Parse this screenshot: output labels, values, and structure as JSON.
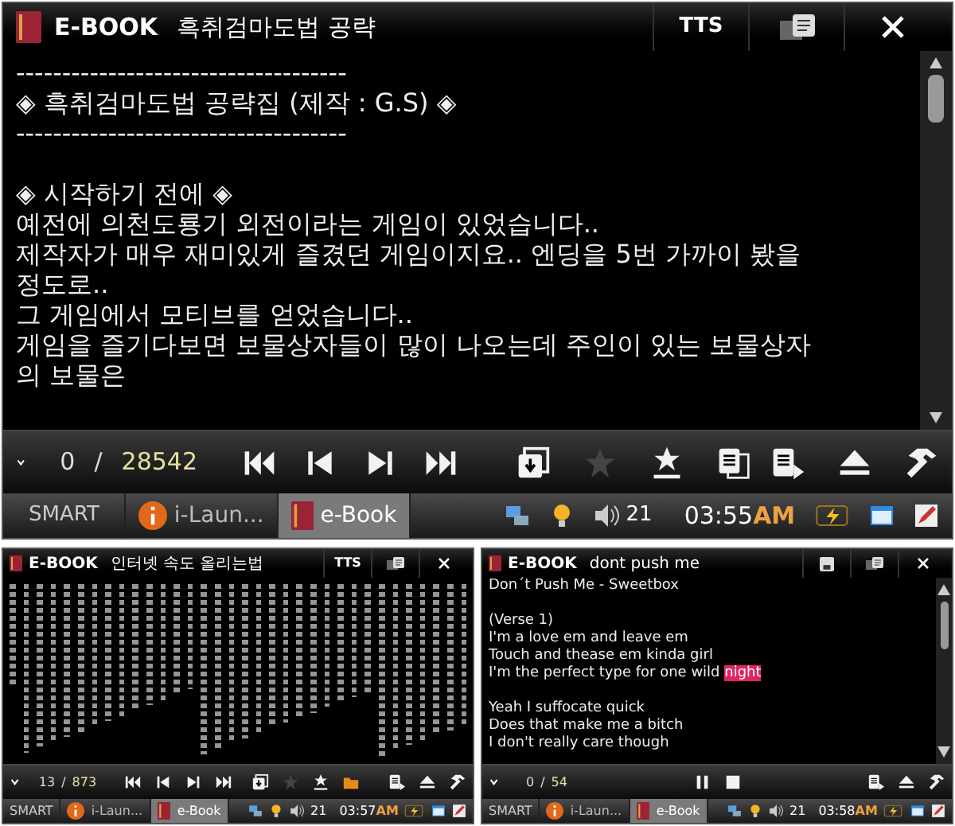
{
  "screens": [
    {
      "window": {
        "app": "E-BOOK",
        "title": "흑취검마도법 공략",
        "buttons": [
          {
            "kind": "text",
            "label": "TTS"
          },
          {
            "kind": "window"
          },
          {
            "kind": "close"
          }
        ]
      },
      "content": {
        "kind": "text",
        "paragraphs": [
          [
            {
              "text": "------------------------------------"
            },
            {
              "text": "◈ 흑취검마도법 공략집 (제작 : G.S) ◈"
            },
            {
              "text": "------------------------------------"
            }
          ],
          [
            {
              "text": "◈ 시작하기 전에 ◈"
            },
            {
              "text": "예전에 의천도룡기 외전이라는 게임이 있었습니다.."
            },
            {
              "text": "제작자가 매우 재미있게 즐겼던 게임이지요.. 엔딩을 5번 가까이 봤을"
            },
            {
              "text": "정도로.."
            },
            {
              "text": "그 게임에서 모티브를 얻었습니다.."
            },
            {
              "text": "게임을 즐기다보면 보물상자들이 많이 나오는데 주인이 있는 보물상자"
            },
            {
              "text": "의 보물은"
            }
          ]
        ]
      },
      "toolbar": {
        "page": "0",
        "separator": "/",
        "total": "28542",
        "navigation": [
          {
            "kind": "first",
            "dimmed": false
          },
          {
            "kind": "prev",
            "dimmed": false
          },
          {
            "kind": "next",
            "dimmed": false
          },
          {
            "kind": "last",
            "dimmed": false
          }
        ],
        "bookmarks": [
          {
            "kind": "save-mark",
            "dimmed": false
          },
          {
            "kind": "star",
            "dimmed": true
          },
          {
            "kind": "star-list",
            "dimmed": false
          },
          {
            "kind": "pages",
            "dimmed": false
          }
        ],
        "tools": [
          {
            "kind": "list-play",
            "dimmed": false
          },
          {
            "kind": "eject",
            "dimmed": false
          },
          {
            "kind": "hammer",
            "dimmed": false
          }
        ]
      },
      "taskbar": {
        "start": "SMART",
        "tasks": [
          {
            "kind": "info",
            "label": "i-Laun...",
            "selected": false
          },
          {
            "kind": "book",
            "label": "e-Book",
            "selected": true
          }
        ],
        "volume": "21",
        "time": "03:55",
        "ampm": "AM"
      }
    },
    {
      "window": {
        "app": "E-BOOK",
        "title": "인터넷 속도 올리는법",
        "buttons": [
          {
            "kind": "text",
            "label": "TTS"
          },
          {
            "kind": "window"
          },
          {
            "kind": "close"
          }
        ]
      },
      "content": {
        "kind": "vertical"
      },
      "toolbar": {
        "page": "13",
        "separator": "/",
        "total": "873",
        "navigation": [
          {
            "kind": "first",
            "dimmed": false
          },
          {
            "kind": "prev",
            "dimmed": false
          },
          {
            "kind": "next",
            "dimmed": false
          },
          {
            "kind": "last",
            "dimmed": false
          }
        ],
        "bookmarks": [
          {
            "kind": "save-mark",
            "dimmed": false
          },
          {
            "kind": "star",
            "dimmed": true
          },
          {
            "kind": "star-list",
            "dimmed": false
          },
          {
            "kind": "folder",
            "dimmed": false
          }
        ],
        "tools": [
          {
            "kind": "list-play",
            "dimmed": false
          },
          {
            "kind": "eject",
            "dimmed": false
          },
          {
            "kind": "hammer",
            "dimmed": false
          }
        ]
      },
      "taskbar": {
        "start": "SMART",
        "tasks": [
          {
            "kind": "info",
            "label": "i-Laun...",
            "selected": false
          },
          {
            "kind": "book",
            "label": "e-Book",
            "selected": true
          }
        ],
        "volume": "21",
        "time": "03:57",
        "ampm": "AM"
      }
    },
    {
      "window": {
        "app": "E-BOOK",
        "title": "dont push me",
        "buttons": [
          {
            "kind": "save"
          },
          {
            "kind": "window"
          },
          {
            "kind": "close"
          }
        ]
      },
      "content": {
        "kind": "text",
        "paragraphs": [
          [
            {
              "text": "Don´t Push Me - Sweetbox"
            }
          ],
          [
            {
              "text": "(Verse 1)"
            },
            {
              "text": "I'm a love em and leave em"
            },
            {
              "text": "Touch and thease em kinda girl"
            },
            {
              "text": "I'm the perfect type for one wild ",
              "highlight": "night"
            }
          ],
          [
            {
              "text": "Yeah I suffocate quick"
            },
            {
              "text": "Does that make me a bitch"
            },
            {
              "text": "I don't really care though"
            }
          ]
        ]
      },
      "toolbar": {
        "page": "0",
        "separator": "/",
        "total": "54",
        "navigation": [
          {
            "kind": "pause",
            "dimmed": false
          },
          {
            "kind": "stop",
            "dimmed": false
          }
        ],
        "tools": [
          {
            "kind": "list-play",
            "dimmed": false
          },
          {
            "kind": "eject",
            "dimmed": false
          },
          {
            "kind": "hammer",
            "dimmed": false
          }
        ]
      },
      "taskbar": {
        "start": "SMART",
        "tasks": [
          {
            "kind": "info",
            "label": "i-Laun...",
            "selected": false
          },
          {
            "kind": "book",
            "label": "e-Book",
            "selected": true
          }
        ],
        "volume": "21",
        "time": "03:58",
        "ampm": "AM"
      }
    }
  ]
}
